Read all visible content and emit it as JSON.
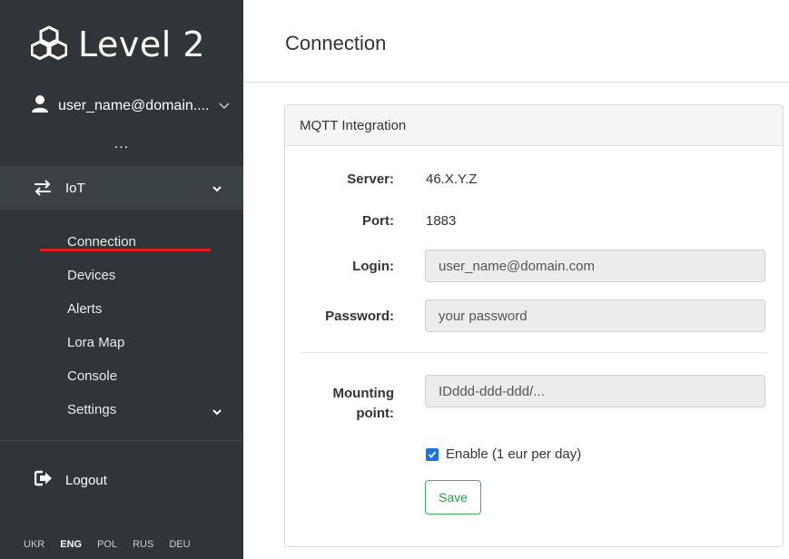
{
  "brand": {
    "name": "Level 2"
  },
  "user": {
    "name": "user_name@domain....",
    "more": "..."
  },
  "nav": {
    "section": {
      "label": "IoT"
    },
    "items": [
      {
        "label": "Connection",
        "active": true
      },
      {
        "label": "Devices"
      },
      {
        "label": "Alerts"
      },
      {
        "label": "Lora Map"
      },
      {
        "label": "Console"
      },
      {
        "label": "Settings"
      }
    ],
    "logout_label": "Logout",
    "languages": [
      "UKR",
      "ENG",
      "POL",
      "RUS",
      "DEU"
    ],
    "current_language": "ENG"
  },
  "page": {
    "title": "Connection"
  },
  "card": {
    "title": "MQTT Integration",
    "server": {
      "label": "Server:",
      "value": "46.X.Y.Z"
    },
    "port": {
      "label": "Port:",
      "value": "1883"
    },
    "login": {
      "label": "Login:",
      "value": "user_name@domain.com"
    },
    "password": {
      "label": "Password:",
      "value": "your password"
    },
    "mounting": {
      "label_line1": "Mounting",
      "label_line2": "point:",
      "value": "IDddd-ddd-ddd/..."
    },
    "enable": {
      "label": "Enable (1 eur per day)",
      "checked": true
    },
    "save_label": "Save"
  },
  "colors": {
    "sidebar": "#2f3538",
    "active_underline": "#e02020",
    "save": "#2e9a4a",
    "checkbox": "#1a73e8"
  }
}
